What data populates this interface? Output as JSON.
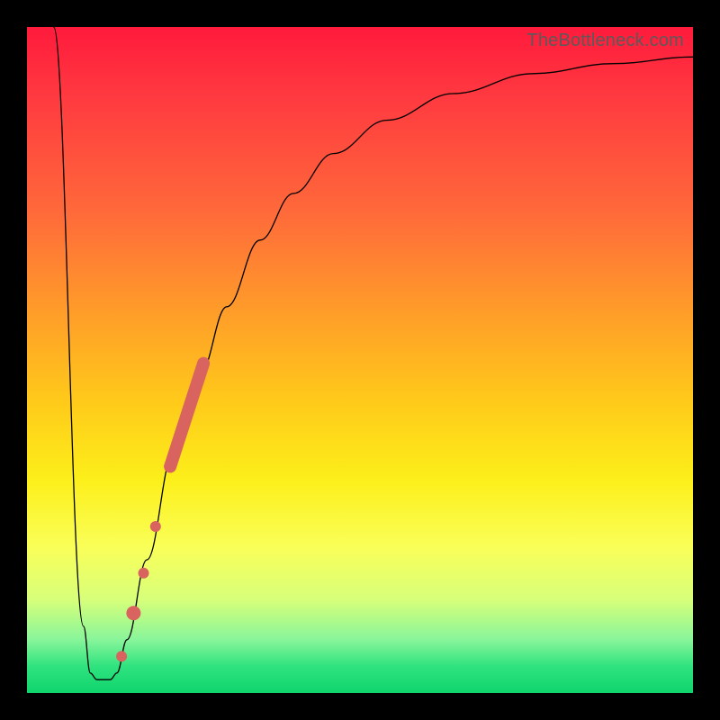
{
  "watermark": "TheBottleneck.com",
  "chart_data": {
    "type": "line",
    "title": "",
    "xlabel": "",
    "ylabel": "",
    "xlim": [
      0,
      100
    ],
    "ylim": [
      0,
      100
    ],
    "grid": false,
    "series": [
      {
        "name": "curve",
        "stroke": "#000000",
        "width": 1.3,
        "points": [
          {
            "x": 4.0,
            "y": 100.0
          },
          {
            "x": 8.5,
            "y": 10.0
          },
          {
            "x": 9.5,
            "y": 3.0
          },
          {
            "x": 10.5,
            "y": 2.0
          },
          {
            "x": 12.5,
            "y": 2.0
          },
          {
            "x": 13.5,
            "y": 3.0
          },
          {
            "x": 15.0,
            "y": 8.0
          },
          {
            "x": 18.0,
            "y": 20.0
          },
          {
            "x": 22.0,
            "y": 36.0
          },
          {
            "x": 26.0,
            "y": 48.0
          },
          {
            "x": 30.0,
            "y": 58.0
          },
          {
            "x": 35.0,
            "y": 68.0
          },
          {
            "x": 40.0,
            "y": 75.0
          },
          {
            "x": 46.0,
            "y": 81.0
          },
          {
            "x": 54.0,
            "y": 86.0
          },
          {
            "x": 64.0,
            "y": 90.0
          },
          {
            "x": 76.0,
            "y": 93.0
          },
          {
            "x": 88.0,
            "y": 94.5
          },
          {
            "x": 100.0,
            "y": 95.5
          }
        ]
      }
    ],
    "overlays": [
      {
        "name": "thick-segment",
        "type": "capsule",
        "stroke": "#d9635e",
        "width": 14,
        "p1": {
          "x": 21.5,
          "y": 34.0
        },
        "p2": {
          "x": 26.5,
          "y": 49.5
        }
      },
      {
        "name": "dot-1",
        "type": "dot",
        "fill": "#d9635e",
        "r": 6,
        "c": {
          "x": 19.3,
          "y": 25.0
        }
      },
      {
        "name": "dot-2",
        "type": "dot",
        "fill": "#d9635e",
        "r": 6,
        "c": {
          "x": 17.5,
          "y": 18.0
        }
      },
      {
        "name": "dot-3",
        "type": "dot",
        "fill": "#d9635e",
        "r": 8,
        "c": {
          "x": 16.0,
          "y": 12.0
        }
      },
      {
        "name": "dot-4",
        "type": "dot",
        "fill": "#d9635e",
        "r": 6,
        "c": {
          "x": 14.2,
          "y": 5.5
        }
      }
    ]
  }
}
